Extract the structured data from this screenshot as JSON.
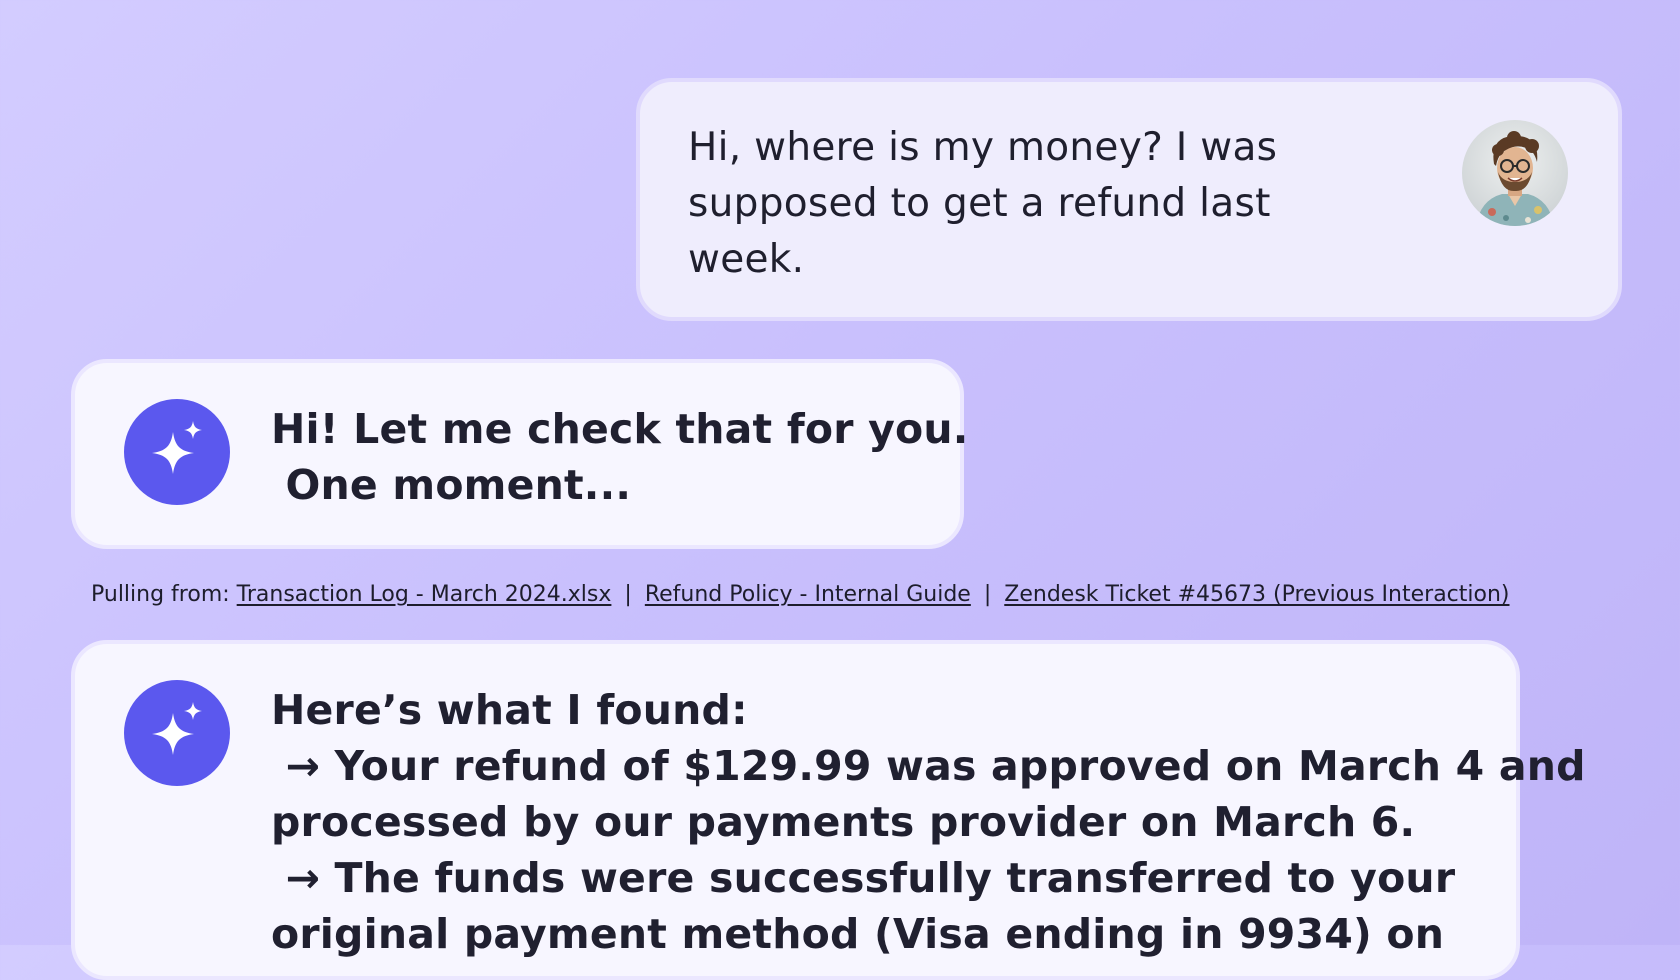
{
  "colors": {
    "background_start": "#d3ccff",
    "background_end": "#bfb4f8",
    "user_bubble": "#efedfd",
    "bot_bubble": "#f7f6ff",
    "bot_icon": "#5b58ee",
    "text": "#1d1d2c"
  },
  "user_message": {
    "text": "Hi, where is my money? I was supposed to get a refund last week.",
    "avatar": "user-avatar-photo"
  },
  "bot_message_1": {
    "icon": "sparkle-icon",
    "lines": [
      "Hi! Let me check that for you.",
      " One moment..."
    ]
  },
  "sources": {
    "label": "Pulling from: ",
    "separator": "|",
    "links": [
      "Transaction Log - March 2024.xlsx",
      "Refund Policy - Internal Guide",
      "Zendesk Ticket #45673 (Previous Interaction)"
    ]
  },
  "bot_message_2": {
    "icon": "sparkle-icon",
    "lines": [
      "Here’s what I found:",
      " → Your refund of $129.99 was approved on March 4 and",
      "processed by our payments provider on March 6.",
      " → The funds were successfully transferred to your",
      "original payment method (Visa ending in 9934) on"
    ]
  }
}
